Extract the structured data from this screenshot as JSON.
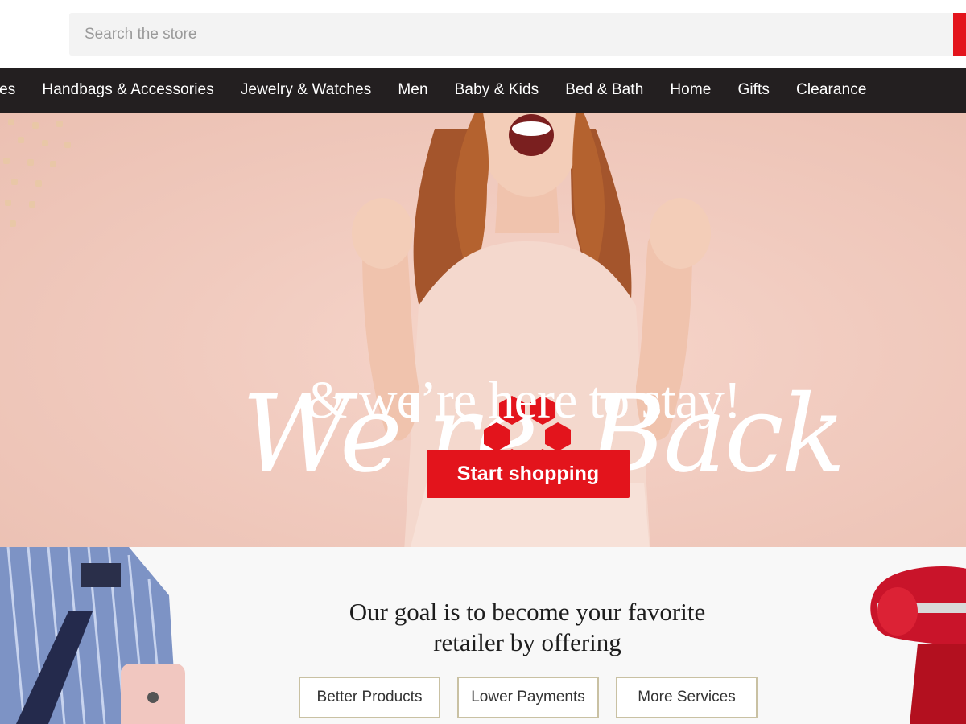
{
  "search": {
    "placeholder": "Search the store",
    "button_icon": "search-icon"
  },
  "nav": {
    "items": [
      {
        "label": "Shoes"
      },
      {
        "label": "Handbags & Accessories"
      },
      {
        "label": "Jewelry & Watches"
      },
      {
        "label": "Men"
      },
      {
        "label": "Baby & Kids"
      },
      {
        "label": "Bed & Bath"
      },
      {
        "label": "Home"
      },
      {
        "label": "Gifts"
      },
      {
        "label": "Clearance"
      }
    ]
  },
  "hero": {
    "script_left": "We're",
    "script_right": "Back",
    "subhead": "& we’re here to stay!",
    "cta_label": "Start shopping",
    "logo_icon": "hexagon-ring-logo-icon"
  },
  "goal": {
    "title_line1": "Our goal is to become your favorite",
    "title_line2": "retailer by offering",
    "pills": [
      "Better Products",
      "Lower Payments",
      "More Services"
    ]
  },
  "colors": {
    "brand_red": "#e3141c",
    "nav_bg": "#231f20",
    "hero_bg": "#f1cbbf",
    "pill_border": "#c9c1a3"
  }
}
